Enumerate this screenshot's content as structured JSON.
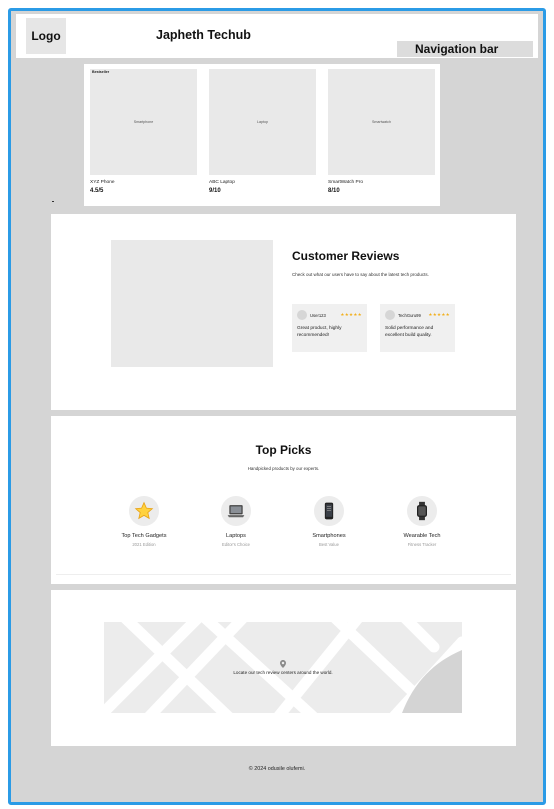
{
  "header": {
    "logo": "Logo",
    "title": "Japheth Techub",
    "nav_label": "Navigation bar"
  },
  "products": [
    {
      "image_label": "Smartphone",
      "badge": "Bestseller",
      "name": "XYZ Phone",
      "rating": "4.5/5"
    },
    {
      "image_label": "Laptop",
      "badge": "",
      "name": "ABC Laptop",
      "rating": "9/10"
    },
    {
      "image_label": "Smartwatch",
      "badge": "",
      "name": "SmartWatch Pro",
      "rating": "8/10"
    }
  ],
  "reviews": {
    "title": "Customer Reviews",
    "subtitle": "Check out what our users have to say about the latest tech products.",
    "cards": [
      {
        "user": "User123",
        "stars": "★★★★★",
        "text": "Great product, highly recommended!"
      },
      {
        "user": "TechGuru99",
        "stars": "★★★★★",
        "text": "Solid performance and excellent build quality."
      }
    ]
  },
  "top_picks": {
    "title": "Top Picks",
    "subtitle": "Handpicked products by our experts.",
    "items": [
      {
        "icon": "star-icon",
        "title": "Top Tech Gadgets",
        "sub": "2021 Edition"
      },
      {
        "icon": "laptop-icon",
        "title": "Laptops",
        "sub": "Editor's Choice"
      },
      {
        "icon": "smartphone-icon",
        "title": "Smartphones",
        "sub": "Best Value"
      },
      {
        "icon": "watch-icon",
        "title": "Wearable Tech",
        "sub": "Fitness Tracker"
      }
    ]
  },
  "map": {
    "caption": "Locate our tech review centers around the world."
  },
  "footer": {
    "text": "© 2024 odusile olufemi."
  }
}
